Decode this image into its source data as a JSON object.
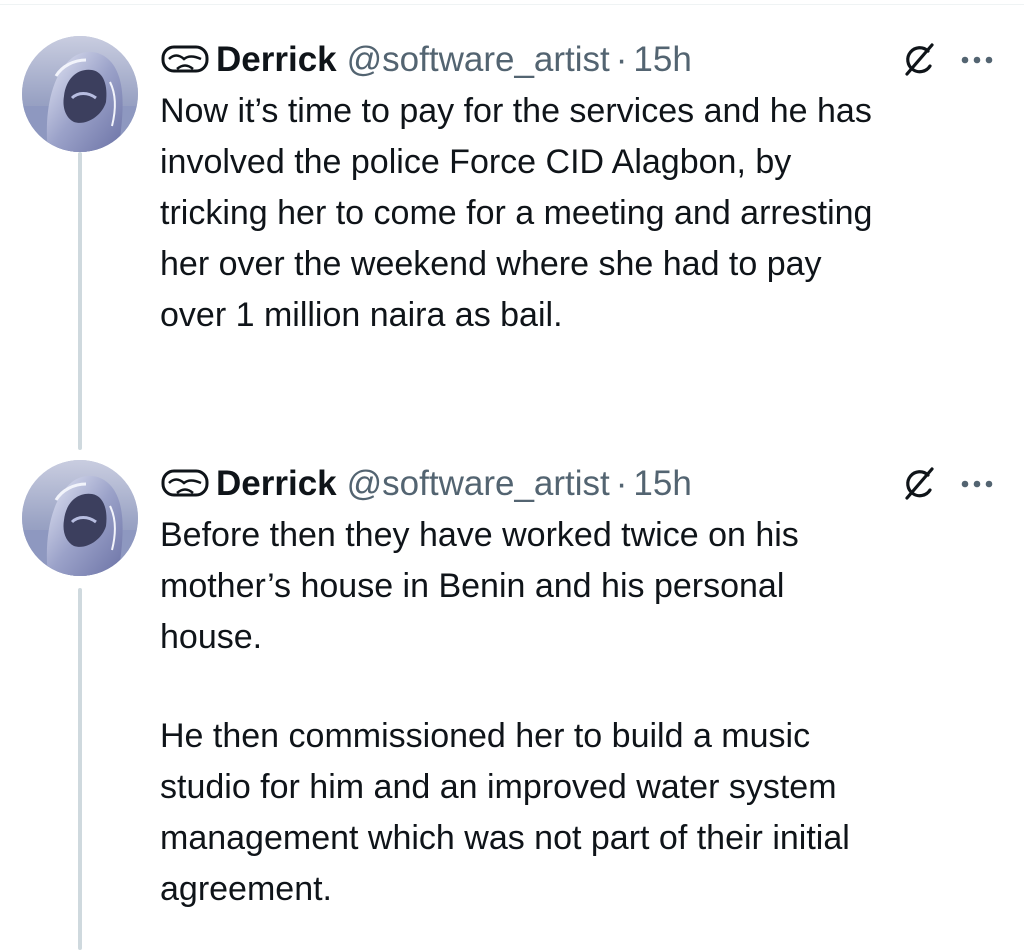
{
  "tweets": [
    {
      "author": {
        "name": "Derrick",
        "handle": "@software_artist",
        "badge_icon": "vr-goggles-icon"
      },
      "separator": "·",
      "time": "15h",
      "paragraphs": [
        "Now it’s time to pay for the services and he has\ninvolved the police Force CID Alagbon, by\ntricking her to come for a meeting and arresting\nher over the weekend where she had to pay\nover 1 million naira as bail."
      ],
      "actions": [
        "grok-icon",
        "more-options-icon"
      ]
    },
    {
      "author": {
        "name": "Derrick",
        "handle": "@software_artist",
        "badge_icon": "vr-goggles-icon"
      },
      "separator": "·",
      "time": "15h",
      "paragraphs": [
        "Before then they have worked twice on his\nmother’s house in Benin and his personal\nhouse.",
        "He then commissioned her to build a music\nstudio for him and an improved water system\nmanagement which was not part of their initial\nagreement."
      ],
      "actions": [
        "grok-icon",
        "more-options-icon"
      ]
    }
  ],
  "colors": {
    "text": "#0f1419",
    "secondary": "#536471",
    "thread_line": "#cfd9de"
  }
}
